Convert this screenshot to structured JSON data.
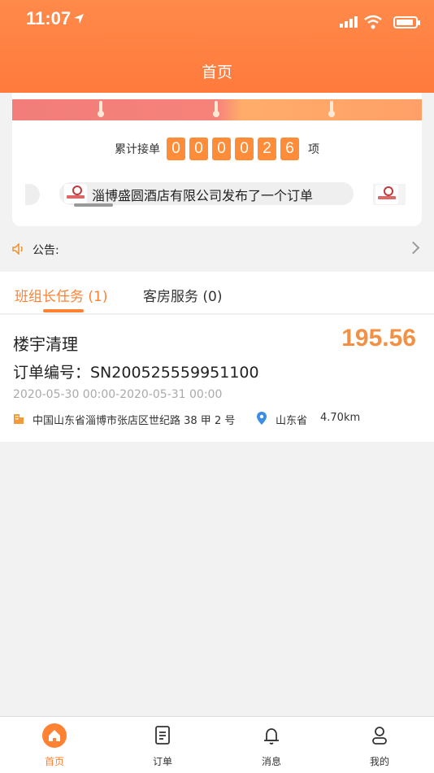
{
  "status_bar": {
    "time": "11:07"
  },
  "nav": {
    "title": "首页"
  },
  "counter": {
    "label": "累计接单",
    "digits": [
      "0",
      "0",
      "0",
      "0",
      "2",
      "6"
    ],
    "suffix": "项"
  },
  "marquee": {
    "text": "淄博盛圆酒店有限公司发布了一个订单"
  },
  "notice": {
    "label": "公告:"
  },
  "tabs": [
    {
      "label": "班组长任务 (1)",
      "active": true
    },
    {
      "label": "客房服务 (0)",
      "active": false
    }
  ],
  "order": {
    "name": "楼宇清理",
    "price": "195.56",
    "number": "订单编号：SN200525559951100",
    "time_range": "2020-05-30 00:00-2020-05-31 00:00",
    "address": "中国山东省淄博市张店区世纪路 38 甲 2 号",
    "province": "山东省",
    "distance": "4.70km"
  },
  "tabbar": [
    {
      "label": "首页",
      "icon": "home-icon",
      "active": true
    },
    {
      "label": "订单",
      "icon": "order-list-icon",
      "active": false
    },
    {
      "label": "消息",
      "icon": "bell-icon",
      "active": false
    },
    {
      "label": "我的",
      "icon": "user-icon",
      "active": false
    }
  ],
  "colors": {
    "accent": "#ff8132",
    "header": "#ff7f40",
    "price": "#f29145"
  }
}
